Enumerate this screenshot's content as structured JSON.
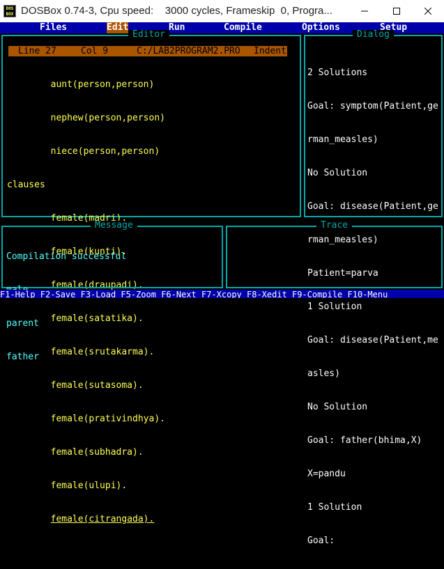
{
  "window": {
    "title": "DOSBox 0.74-3, Cpu speed:    3000 cycles, Frameskip  0, Progra...",
    "icon_text": "DOS BOX",
    "minimize_icon": "minimize-icon",
    "maximize_icon": "maximize-icon",
    "close_icon": "close-icon"
  },
  "menu": {
    "items": [
      "Files",
      "Edit",
      "Run",
      "Compile",
      "Options",
      "Setup"
    ],
    "selected": "Edit"
  },
  "editor": {
    "title": "Editor",
    "status": {
      "line": "Line 27",
      "col": "Col 9",
      "file": "C:/LAB2PROGRAM2.PRO",
      "mode": "Indent"
    },
    "lines": [
      "        aunt(person,person)",
      "        nephew(person,person)",
      "        niece(person,person)",
      "clauses",
      "        female(madri).",
      "        female(kunti).",
      "        female(draupadi).",
      "        female(satatika).",
      "        female(srutakarma).",
      "        female(sutasoma).",
      "        female(prativindhya).",
      "        female(subhadra).",
      "        female(ulupi).",
      "female(citrangada)."
    ],
    "last_line_indent": "        "
  },
  "dialog": {
    "title": "Dialog",
    "lines": [
      "2 Solutions",
      "Goal: symptom(Patient,ge",
      "rman_measles)",
      "No Solution",
      "Goal: disease(Patient,ge",
      "rman_measles)",
      "Patient=parva",
      "1 Solution",
      "Goal: disease(Patient,me",
      "asles)",
      "No Solution",
      "Goal: father(bhima,X)",
      "X=pandu",
      "1 Solution",
      "Goal:"
    ]
  },
  "message": {
    "title": "Message",
    "lines": [
      "Compilation successful",
      "male",
      "parent",
      "father"
    ]
  },
  "trace": {
    "title": "Trace"
  },
  "function_keys": "F1-Help F2-Save F3-Load F5-Zoom F6-Next F7-Xcopy F8-Xedit F9-Compile F10-Menu"
}
